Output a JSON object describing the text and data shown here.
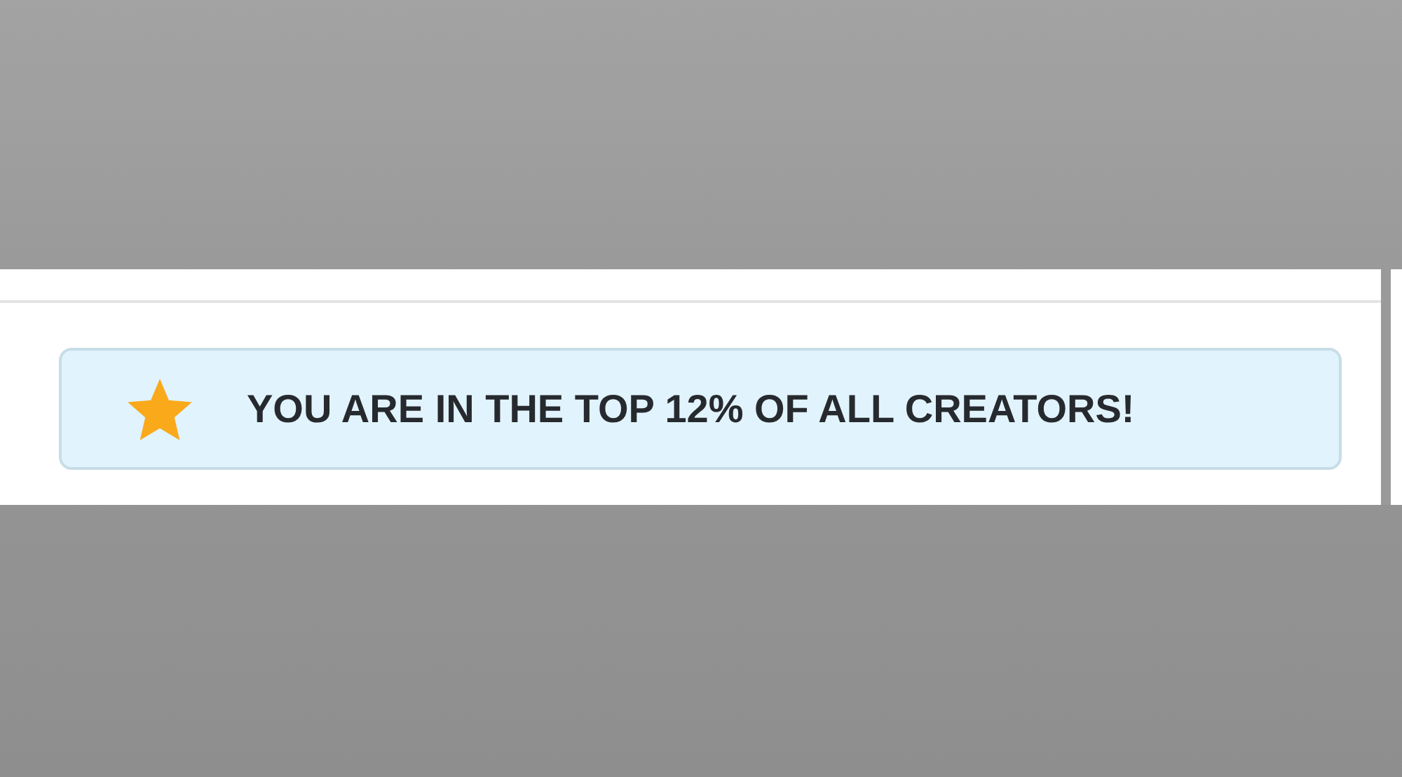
{
  "banner": {
    "text": "YOU ARE IN THE TOP 12% OF ALL CREATORS!"
  }
}
